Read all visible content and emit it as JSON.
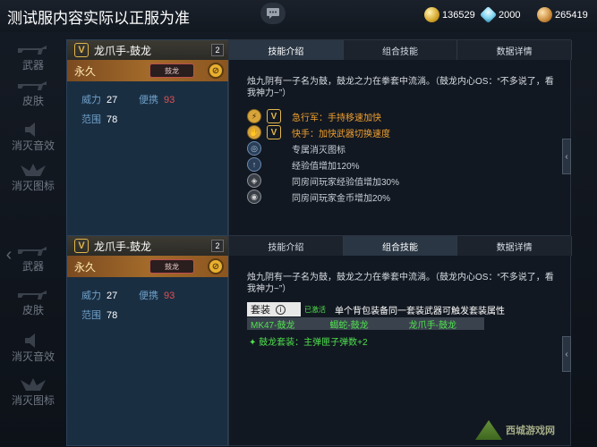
{
  "header": {
    "title": "测试服内容实际以正服为准",
    "currencies": [
      {
        "icon": "gold-coin-icon",
        "value": "136529"
      },
      {
        "icon": "diamond-icon",
        "value": "2000"
      },
      {
        "icon": "medal-icon",
        "value": "265419"
      }
    ]
  },
  "sidebar": {
    "items": [
      {
        "label": "武器"
      },
      {
        "label": "皮肤"
      },
      {
        "label": "消灭音效"
      },
      {
        "label": "消灭图标"
      }
    ]
  },
  "panels": [
    {
      "weapon_name": "龙爪手-鼓龙",
      "count": "2",
      "duration": "永久",
      "mini_badge": "鼓龙",
      "stats": {
        "power_label": "威力",
        "power_value": "27",
        "carry_label": "便携",
        "carry_value": "93",
        "range_label": "范围",
        "range_value": "78"
      },
      "tabs": [
        "技能介绍",
        "组合技能",
        "数据详情"
      ],
      "active_tab": 0,
      "description": "烛九阴有一子名为鼓，鼓龙之力在拳套中流淌。（鼓龙内心OS：“不多说了，看我神力~”）",
      "bonuses": [
        {
          "text": "急行军：手持移速加快"
        },
        {
          "text": "快手：加快武器切换速度"
        },
        {
          "text": "专属消灭图标"
        },
        {
          "text": "经验值增加120%"
        },
        {
          "text": "同房间玩家经验值增加30%"
        },
        {
          "text": "同房间玩家金币增加20%"
        }
      ]
    },
    {
      "weapon_name": "龙爪手-鼓龙",
      "count": "2",
      "duration": "永久",
      "mini_badge": "鼓龙",
      "stats": {
        "power_label": "威力",
        "power_value": "27",
        "carry_label": "便携",
        "carry_value": "93",
        "range_label": "范围",
        "range_value": "78"
      },
      "tabs": [
        "技能介绍",
        "组合技能",
        "数据详情"
      ],
      "active_tab": 1,
      "description": "烛九阴有一子名为鼓，鼓龙之力在拳套中流淌。（鼓龙内心OS：“不多说了，看我神力~”）",
      "set": {
        "tag": "套装",
        "status": "已激活",
        "desc": "单个背包装备同一套装武器可触发套装属性",
        "items": [
          "MK47-鼓龙",
          "蝎蛇-鼓龙",
          "龙爪手-鼓龙"
        ],
        "bonus": "鼓龙套装：主弹匣子弹数+2"
      }
    }
  ],
  "watermark": {
    "text": "西城游戏网"
  }
}
